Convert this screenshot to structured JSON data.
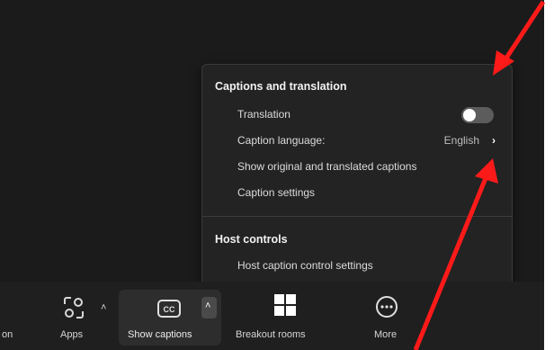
{
  "captions_menu": {
    "section1_title": "Captions and translation",
    "translation_label": "Translation",
    "translation_enabled": false,
    "caption_language_label": "Caption language:",
    "caption_language_value": "English",
    "show_original_label": "Show original and translated captions",
    "caption_settings_label": "Caption settings",
    "section2_title": "Host controls",
    "host_caption_label": "Host caption control settings"
  },
  "toolbar": {
    "partial_left_label": "on",
    "apps_label": "Apps",
    "show_captions_label": "Show captions",
    "breakout_rooms_label": "Breakout rooms",
    "more_label": "More"
  },
  "colors": {
    "background": "#1b1b1b",
    "menu_background": "#232323",
    "annotation_arrow": "#ff1a1a"
  },
  "icons": {
    "apps": "apps-icon",
    "captions": "cc-icon",
    "breakout_rooms": "grid-icon",
    "more": "ellipsis-circle-icon",
    "chevron": "chevron-up-icon"
  }
}
